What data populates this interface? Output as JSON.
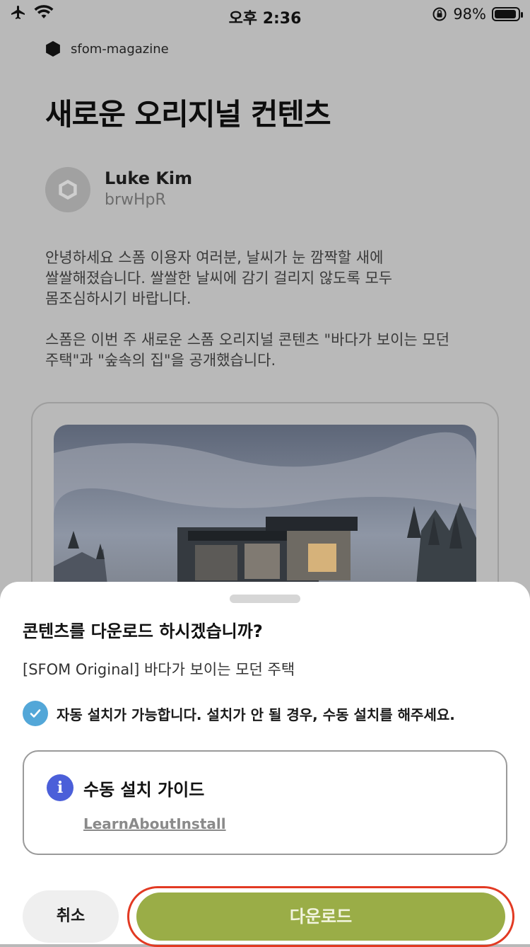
{
  "status_bar": {
    "time": "오후 2:36",
    "battery": "98%"
  },
  "article": {
    "brand": "sfom-magazine",
    "title": "새로운 오리지널 컨텐츠",
    "author_name": "Luke Kim",
    "author_id": "brwHpR",
    "paragraph1": [
      "안녕하세요 스폼 이용자 여러분, 날씨가 눈 깜짝할 새에",
      "쌀쌀해졌습니다. 쌀쌀한 날씨에 감기 걸리지 않도록 모두",
      "몸조심하시기 바랍니다."
    ],
    "paragraph2": [
      "스폼은 이번 주 새로운 스폼 오리지널 콘텐츠 \"바다가 보이는 모던",
      "주택\"과 \"숲속의 집\"을 공개했습니다."
    ]
  },
  "sheet": {
    "title": "콘텐츠를 다운로드 하시겠습니까?",
    "subtitle": "[SFOM Original] 바다가 보이는 모던 주택",
    "notice": "자동 설치가 가능합니다. 설치가 안 될 경우, 수동 설치를 해주세요.",
    "guide_title": "수동 설치 가이드",
    "guide_link": "LearnAboutInstall",
    "cancel_label": "취소",
    "download_label": "다운로드"
  },
  "colors": {
    "accent": "#9aad47",
    "highlight": "#e23a23",
    "info": "#4b5fd9",
    "check": "#53a7d8"
  }
}
